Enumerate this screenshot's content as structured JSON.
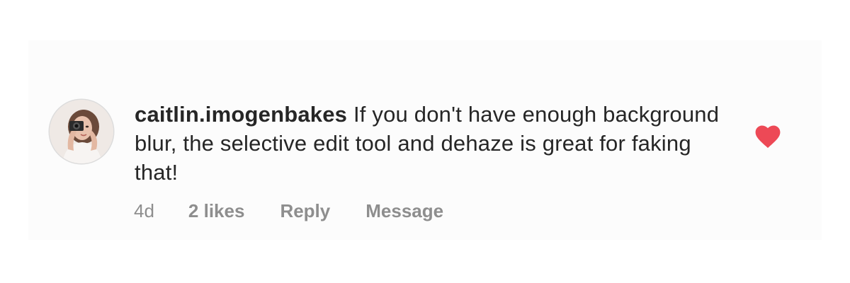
{
  "comment": {
    "username": "caitlin.imogenbakes",
    "text": "If you don't have enough background blur, the selective edit tool and dehaze is great for faking that!",
    "timestamp": "4d",
    "likes_label": "2 likes",
    "reply_label": "Reply",
    "message_label": "Message",
    "liked": true,
    "like_icon": "heart-filled-icon",
    "like_color": "#ed4956",
    "avatar_alt_icon": "user-avatar-photo"
  },
  "colors": {
    "text": "#262626",
    "secondary_text": "#8e8e8e",
    "card_background": "#fcfcfc",
    "page_background": "#ffffff"
  }
}
